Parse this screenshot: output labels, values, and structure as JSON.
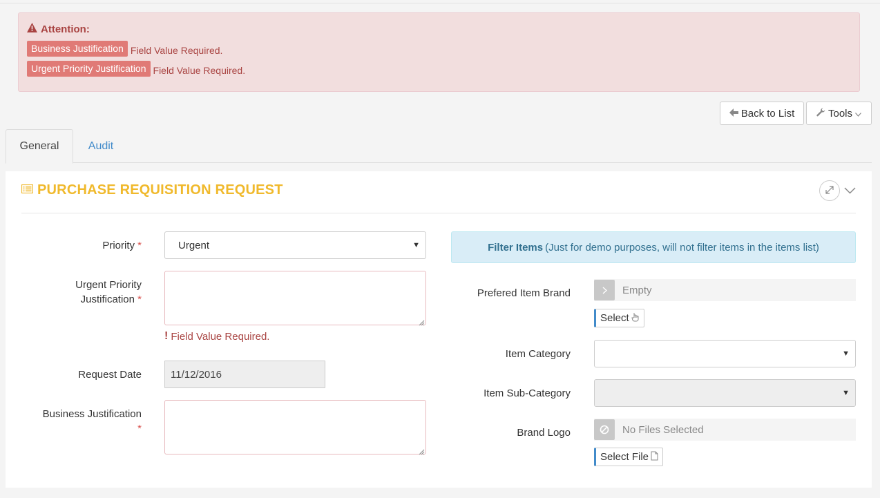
{
  "alert": {
    "title": "Attention:",
    "errors": [
      {
        "field": "Business Justification",
        "message": "Field Value Required."
      },
      {
        "field": "Urgent Priority Justification",
        "message": "Field Value Required."
      }
    ]
  },
  "toolbar": {
    "back_label": "Back to List",
    "tools_label": "Tools"
  },
  "tabs": [
    {
      "label": "General",
      "active": true
    },
    {
      "label": "Audit",
      "active": false
    }
  ],
  "panel": {
    "title": "PURCHASE REQUISITION REQUEST"
  },
  "form": {
    "priority": {
      "label": "Priority",
      "required_mark": "*",
      "value": "Urgent"
    },
    "urgent_justification": {
      "label_line1": "Urgent Priority",
      "label_line2": "Justification",
      "required_mark": "*",
      "value": "",
      "error": "Field Value Required."
    },
    "request_date": {
      "label": "Request Date",
      "value": "11/12/2016"
    },
    "business_justification": {
      "label": "Business Justification",
      "required_mark": "*",
      "value": ""
    }
  },
  "filter": {
    "title": "Filter Items",
    "note": "(Just for demo purposes, will not filter items in the items list)",
    "preferred_brand": {
      "label": "Prefered Item Brand",
      "value": "Empty",
      "button": "Select"
    },
    "item_category": {
      "label": "Item Category",
      "value": ""
    },
    "item_sub_category": {
      "label": "Item Sub-Category",
      "value": ""
    },
    "brand_logo": {
      "label": "Brand Logo",
      "value": "No Files Selected",
      "button": "Select File"
    }
  },
  "colors": {
    "accent": "#f0b92c",
    "alert_bg": "#f2dede",
    "alert_text": "#a94442",
    "link": "#428bca",
    "info_bg": "#d9edf7"
  }
}
